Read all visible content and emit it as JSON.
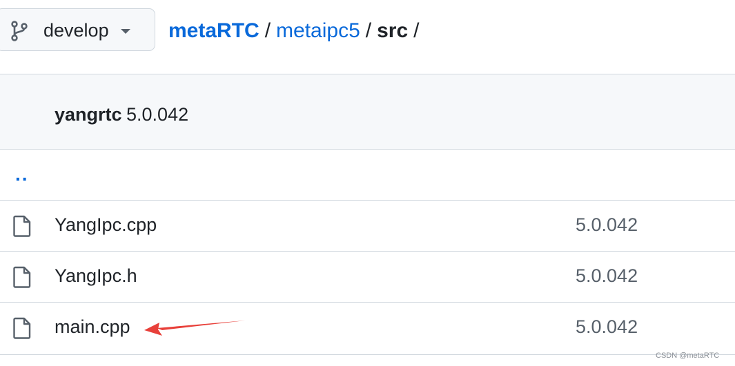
{
  "branch": {
    "label": "develop",
    "icon": "git-branch-icon"
  },
  "breadcrumb": {
    "owner": "metaRTC",
    "repo": "metaipc5",
    "current": "src",
    "separator": "/"
  },
  "commit": {
    "author": "yangrtc",
    "message": "5.0.042"
  },
  "files": {
    "parent": "..",
    "items": [
      {
        "name": "YangIpc.cpp",
        "commit": "5.0.042",
        "icon": "file-icon"
      },
      {
        "name": "YangIpc.h",
        "commit": "5.0.042",
        "icon": "file-icon"
      },
      {
        "name": "main.cpp",
        "commit": "5.0.042",
        "icon": "file-icon"
      }
    ]
  },
  "annotation": {
    "arrow_color": "#e8403a"
  },
  "watermark": "CSDN @metaRTC",
  "colors": {
    "link": "#0969da",
    "border": "#d0d7de",
    "header_bg": "#f6f8fa",
    "text": "#1f2328",
    "muted": "#57606a"
  }
}
